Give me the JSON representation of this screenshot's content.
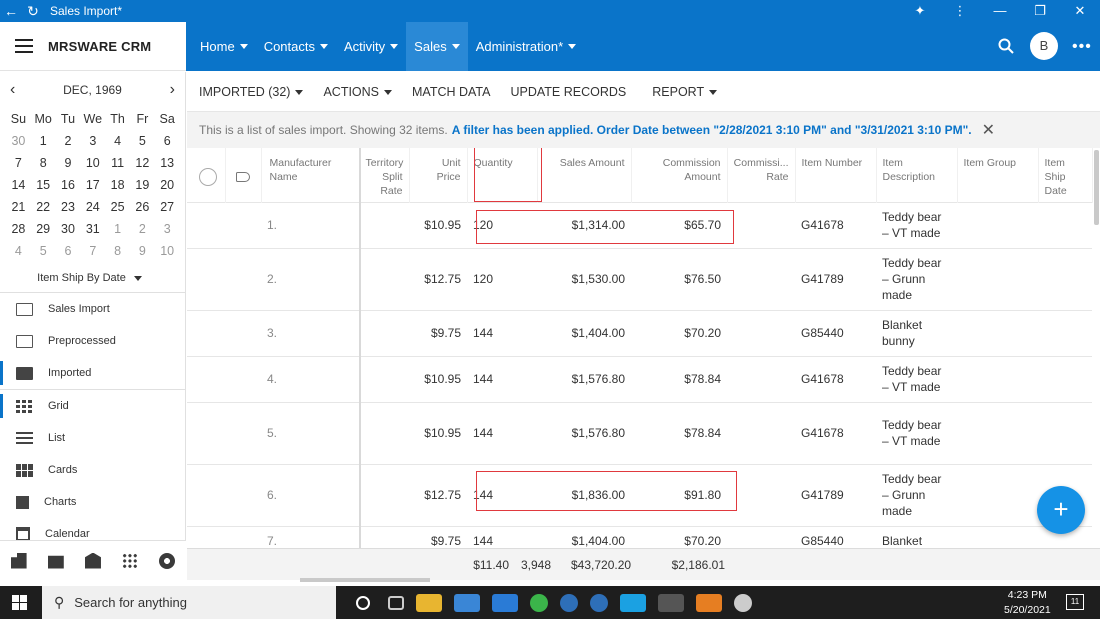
{
  "window": {
    "title": "Sales Import*"
  },
  "app": {
    "brand": "MRSWARE CRM",
    "avatar_initial": "B"
  },
  "nav": {
    "items": [
      "Home",
      "Contacts",
      "Activity",
      "Sales",
      "Administration*"
    ],
    "active": "Sales"
  },
  "calendar": {
    "month_label": "DEC, 1969",
    "weekdays": [
      "Su",
      "Mo",
      "Tu",
      "We",
      "Th",
      "Fr",
      "Sa"
    ],
    "weeks": [
      [
        "30",
        "1",
        "2",
        "3",
        "4",
        "5",
        "6"
      ],
      [
        "7",
        "8",
        "9",
        "10",
        "11",
        "12",
        "13"
      ],
      [
        "14",
        "15",
        "16",
        "17",
        "18",
        "19",
        "20"
      ],
      [
        "21",
        "22",
        "23",
        "24",
        "25",
        "26",
        "27"
      ],
      [
        "28",
        "29",
        "30",
        "31",
        "1",
        "2",
        "3"
      ],
      [
        "4",
        "5",
        "6",
        "7",
        "8",
        "9",
        "10"
      ]
    ],
    "filter_label": "Item Ship By Date"
  },
  "sidebar": {
    "folders": [
      {
        "label": "Sales Import",
        "icon": "folder-icon"
      },
      {
        "label": "Preprocessed",
        "icon": "folder-icon"
      },
      {
        "label": "Imported",
        "icon": "folder-filled-icon",
        "selected": true
      }
    ],
    "views": [
      {
        "label": "Grid",
        "icon": "grid-icon",
        "selected": true
      },
      {
        "label": "List",
        "icon": "list-icon"
      },
      {
        "label": "Cards",
        "icon": "cards-icon"
      },
      {
        "label": "Charts",
        "icon": "bar-chart-icon"
      },
      {
        "label": "Calendar",
        "icon": "calendar-icon"
      }
    ]
  },
  "toolbar": {
    "imported": "IMPORTED (32)",
    "actions": "ACTIONS",
    "match": "MATCH DATA",
    "update": "UPDATE RECORDS",
    "report": "REPORT"
  },
  "info": {
    "text": "This is a list of sales import. Showing 32 items.",
    "filter": "A filter has been applied. Order Date between \"2/28/2021 3:10 PM\" and \"3/31/2021 3:10 PM\"."
  },
  "columns": [
    "Manufacturer Name",
    "Territory Split Rate",
    "Unit Price",
    "Quantity",
    "Sales Amount",
    "Commission Amount",
    "Commissi... Rate",
    "Item Number",
    "Item Description",
    "Item Group",
    "Item Ship Date"
  ],
  "rows": [
    {
      "n": "1.",
      "price": "$10.95",
      "qty": "120",
      "sales": "$1,314.00",
      "comm": "$65.70",
      "item": "G41678",
      "desc": "Teddy bear – VT made"
    },
    {
      "n": "2.",
      "price": "$12.75",
      "qty": "120",
      "sales": "$1,530.00",
      "comm": "$76.50",
      "item": "G41789",
      "desc": "Teddy bear – Grunn made"
    },
    {
      "n": "3.",
      "price": "$9.75",
      "qty": "144",
      "sales": "$1,404.00",
      "comm": "$70.20",
      "item": "G85440",
      "desc": "Blanket bunny"
    },
    {
      "n": "4.",
      "price": "$10.95",
      "qty": "144",
      "sales": "$1,576.80",
      "comm": "$78.84",
      "item": "G41678",
      "desc": "Teddy bear – VT made"
    },
    {
      "n": "5.",
      "price": "$10.95",
      "qty": "144",
      "sales": "$1,576.80",
      "comm": "$78.84",
      "item": "G41678",
      "desc": "Teddy bear – VT made"
    },
    {
      "n": "6.",
      "price": "$12.75",
      "qty": "144",
      "sales": "$1,836.00",
      "comm": "$91.80",
      "item": "G41789",
      "desc": "Teddy bear – Grunn made"
    },
    {
      "n": "7.",
      "price": "$9.75",
      "qty": "144",
      "sales": "$1,404.00",
      "comm": "$70.20",
      "item": "G85440",
      "desc": "Blanket"
    }
  ],
  "totals": {
    "price": "$11.40",
    "qty": "3,948",
    "sales": "$43,720.20",
    "comm": "$2,186.01"
  },
  "taskbar": {
    "search": "Search for anything",
    "time": "4:23 PM",
    "date": "5/20/2021",
    "badge": "11"
  }
}
